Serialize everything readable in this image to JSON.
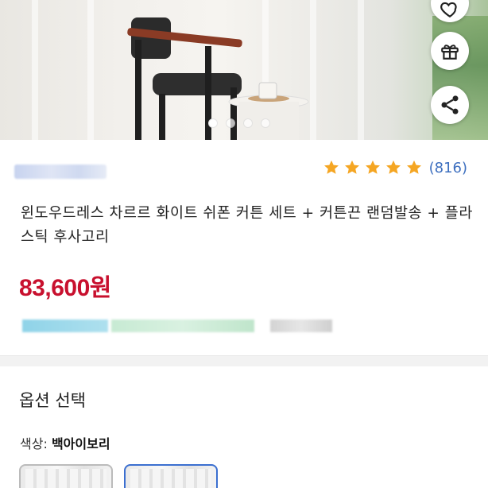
{
  "product": {
    "title": "윈도우드레스 차르르 화이트 쉬폰 커튼 세트 + 커튼끈 랜덤발송 + 플라스틱 후사고리",
    "price": "83,600원",
    "rating": {
      "stars": 5,
      "review_count": "(816)"
    }
  },
  "gallery": {
    "slide_count": 4,
    "active_slide": 1
  },
  "options": {
    "section_title": "옵션 선택",
    "color_label": "색상:",
    "color_value": "백아이보리"
  },
  "icons": {
    "wishlist": "heart-icon",
    "gift": "gift-icon",
    "share": "share-icon",
    "rating": "star-icon"
  },
  "colors": {
    "price": "#c8102e",
    "star": "#f5a623",
    "review_count": "#3d6fbf",
    "selected_border": "#3b6fd0"
  }
}
